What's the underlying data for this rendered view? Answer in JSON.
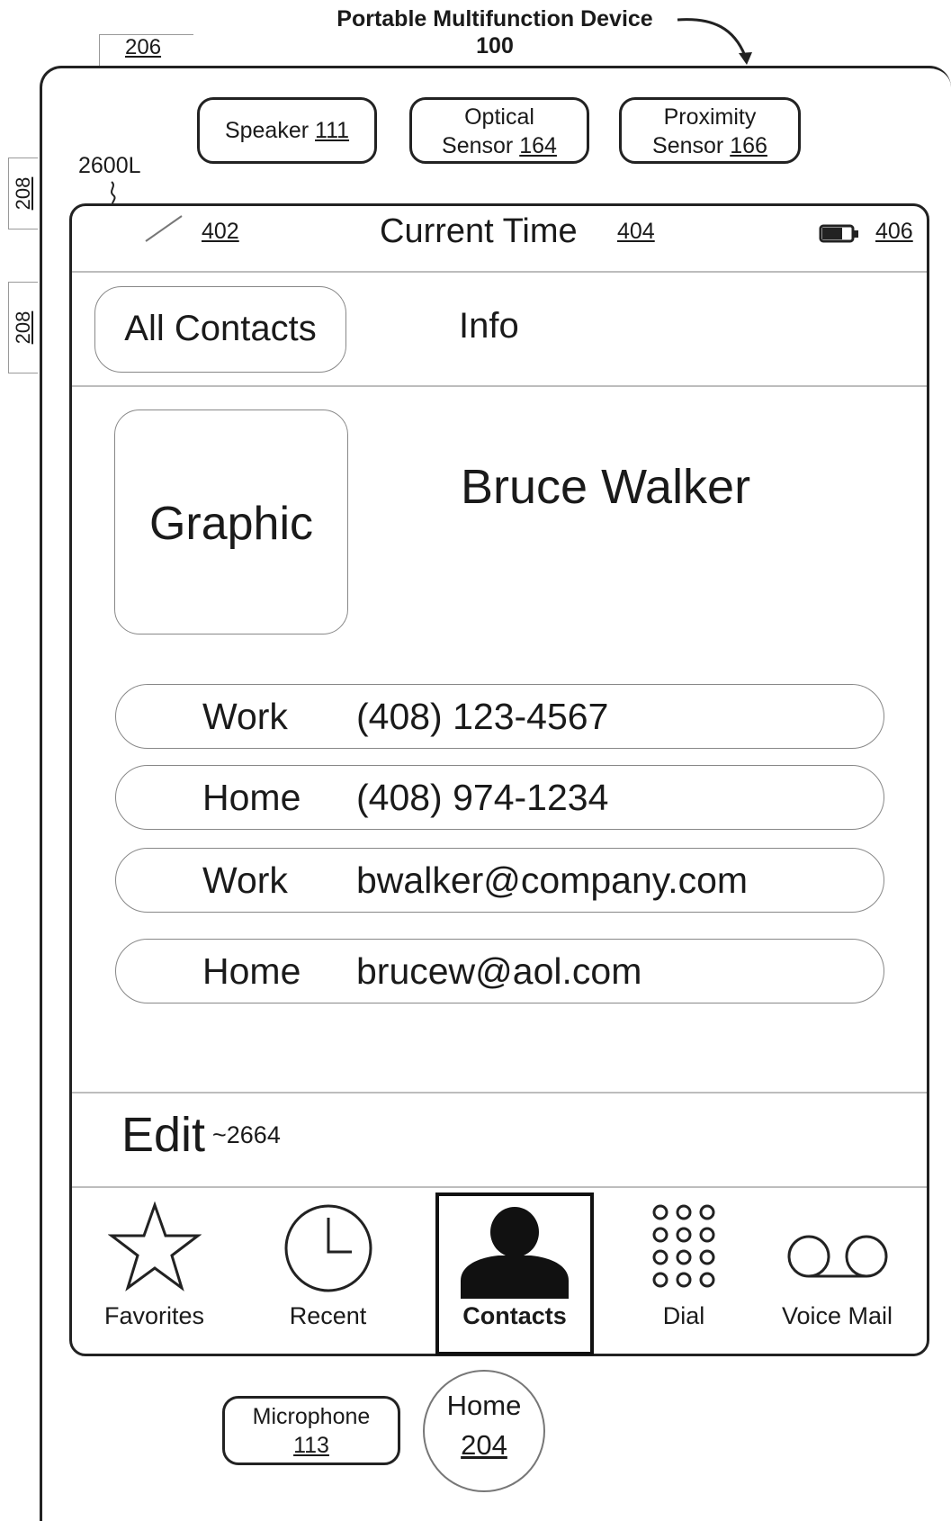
{
  "figure": {
    "title_line1": "Portable Multifunction Device",
    "title_line2": "100"
  },
  "refs": {
    "top_side": "206",
    "side_button_1": "208",
    "side_button_2": "208",
    "screen": "2600L"
  },
  "sensors": {
    "speaker": {
      "label": "Speaker",
      "num": "111"
    },
    "optical": {
      "line1": "Optical",
      "line2": "Sensor",
      "num": "164"
    },
    "proximity": {
      "line1": "Proximity",
      "line2": "Sensor",
      "num": "166"
    }
  },
  "status_bar": {
    "signal_ref": "402",
    "title": "Current Time",
    "title_ref": "404",
    "battery_ref": "406"
  },
  "nav": {
    "back_label": "All Contacts",
    "title": "Info"
  },
  "contact": {
    "graphic_label": "Graphic",
    "name": "Bruce Walker",
    "fields": [
      {
        "label": "Work",
        "value": "(408) 123-4567"
      },
      {
        "label": "Home",
        "value": "(408) 974-1234"
      },
      {
        "label": "Work",
        "value": "bwalker@company.com"
      },
      {
        "label": "Home",
        "value": "brucew@aol.com"
      }
    ]
  },
  "edit": {
    "label": "Edit",
    "ref": "~2664"
  },
  "tabbar": {
    "items": [
      {
        "label": "Favorites",
        "icon": "star-icon"
      },
      {
        "label": "Recent",
        "icon": "clock-icon"
      },
      {
        "label": "Contacts",
        "icon": "person-icon",
        "selected": true
      },
      {
        "label": "Dial",
        "icon": "keypad-icon"
      },
      {
        "label": "Voice Mail",
        "icon": "voicemail-icon"
      }
    ]
  },
  "hardware": {
    "microphone": {
      "label": "Microphone",
      "num": "113"
    },
    "home": {
      "label": "Home",
      "num": "204"
    }
  }
}
